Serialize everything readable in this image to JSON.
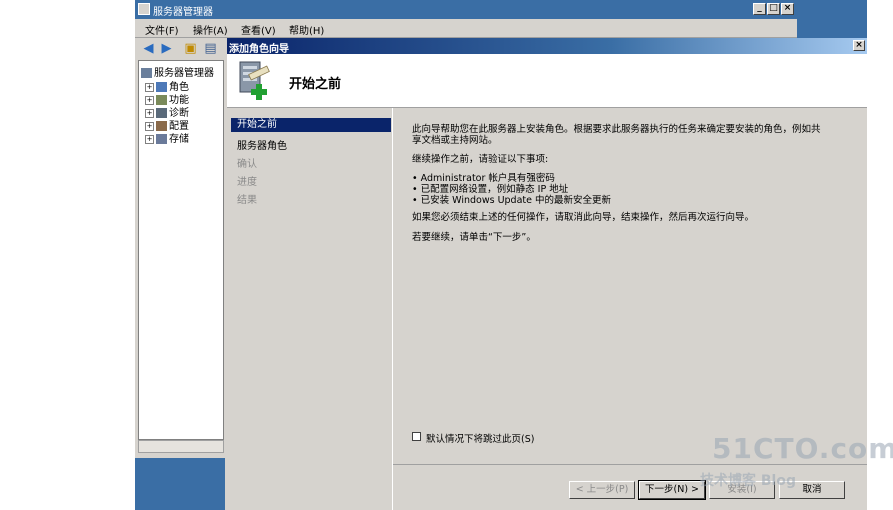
{
  "server_manager": {
    "title": "服务器管理器",
    "window_buttons": {
      "minimize": "_",
      "maximize": "□",
      "close": "×"
    },
    "menu": [
      "文件(F)",
      "操作(A)",
      "查看(V)",
      "帮助(H)"
    ],
    "tree": {
      "root": "服务器管理器",
      "items": [
        "角色",
        "功能",
        "诊断",
        "配置",
        "存储"
      ]
    }
  },
  "wizard": {
    "title": "添加角色向导",
    "close": "×",
    "header_title": "开始之前",
    "nav": [
      {
        "label": "开始之前",
        "state": "active"
      },
      {
        "label": "服务器角色",
        "state": "enabled"
      },
      {
        "label": "确认",
        "state": "disabled"
      },
      {
        "label": "进度",
        "state": "disabled"
      },
      {
        "label": "结果",
        "state": "disabled"
      }
    ],
    "content": {
      "para1_line1": "此向导帮助您在此服务器上安装角色。根据要求此服务器执行的任务来确定要安装的角色，例如共",
      "para1_line2": "享文档或主持网站。",
      "para2": "继续操作之前，请验证以下事项:",
      "bullets": [
        "• Administrator 帐户具有强密码",
        "• 已配置网络设置，例如静态 IP 地址",
        "• 已安装 Windows Update 中的最新安全更新"
      ],
      "para3": "如果您必须结束上述的任何操作，请取消此向导，结束操作，然后再次运行向导。",
      "para4": "若要继续，请单击“下一步”。"
    },
    "skip_checkbox_label": "默认情况下将跳过此页(S)",
    "buttons": {
      "prev": "< 上一步(P)",
      "next": "下一步(N) >",
      "install": "安装(I)",
      "cancel": "取消"
    }
  },
  "watermark": {
    "line1": "51CTO.com",
    "line2": "技术博客 Blog"
  },
  "colors": {
    "titlebar_blue": "#3a6ea5",
    "selection_blue": "#0a246a",
    "dialog_gray": "#d6d3ce"
  }
}
